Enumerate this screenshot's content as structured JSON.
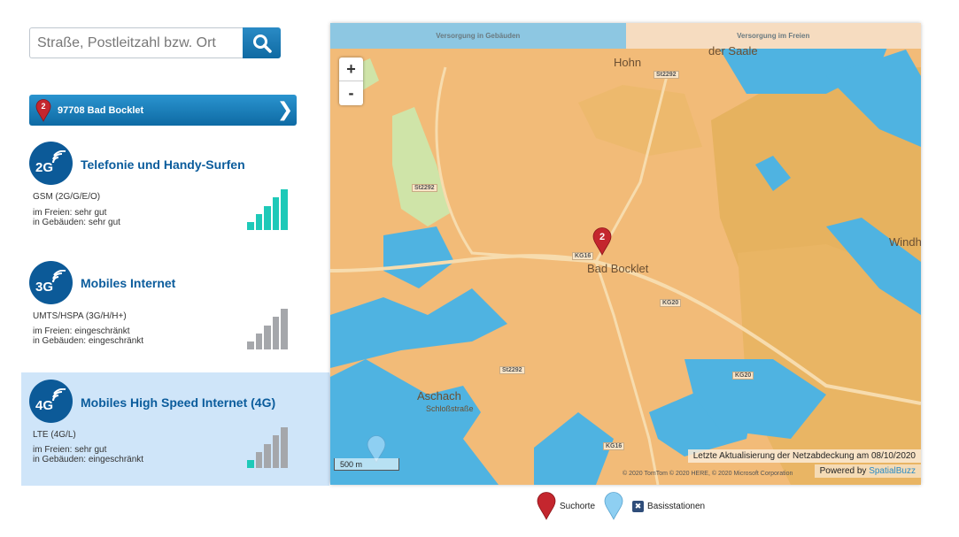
{
  "search": {
    "placeholder": "Straße, Postleitzahl bzw. Ort"
  },
  "location": {
    "pin_number": "2",
    "label": "97708 Bad Bocklet"
  },
  "networks": [
    {
      "badge": "2G",
      "title": "Telefonie und Handy-Surfen",
      "tech": "GSM (2G/G/E/O)",
      "outdoor": "im Freien: sehr gut",
      "indoor": "in Gebäuden: sehr gut",
      "signal_level": 5,
      "signal_max": 5,
      "selected": false
    },
    {
      "badge": "3G",
      "title": "Mobiles Internet",
      "tech": "UMTS/HSPA (3G/H/H+)",
      "outdoor": "im Freien: eingeschränkt",
      "indoor": "in Gebäuden: eingeschränkt",
      "signal_level": 0,
      "signal_max": 5,
      "selected": false
    },
    {
      "badge": "4G",
      "title": "Mobiles High Speed Internet (4G)",
      "tech": "LTE (4G/L)",
      "outdoor": "im Freien: sehr gut",
      "indoor": "in Gebäuden: eingeschränkt",
      "signal_level": 1,
      "signal_max": 5,
      "selected": true
    }
  ],
  "map": {
    "tabs": {
      "indoor": "Versorgung in Gebäuden",
      "outdoor": "Versorgung im Freien"
    },
    "zoom_in": "+",
    "zoom_out": "-",
    "scale": "500 m",
    "places": [
      "Hohn",
      "Bad Bocklet",
      "Aschach",
      "Schloßstraße",
      "der Saale",
      "Windh"
    ],
    "roads": [
      "St2292",
      "St2292",
      "KG16",
      "KG20",
      "St2292",
      "KG20",
      "KG16"
    ],
    "marker_number": "2",
    "update_text": "Letzte Aktualisierung der Netzabdeckung am 08/10/2020",
    "powered_prefix": "Powered by ",
    "powered_brand": "SpatialBuzz",
    "copyright": "© 2020 TomTom © 2020 HERE, © 2020 Microsoft Corporation"
  },
  "legend": {
    "search_places": "Suchorte",
    "base_stations": "Basisstationen"
  },
  "colors": {
    "signal_on": "#1ec9b8",
    "signal_off": "#a5a7ab",
    "brand": "#0b5c9c",
    "coverage_good": "#f2bb78",
    "coverage_water": "#4db3e0"
  }
}
